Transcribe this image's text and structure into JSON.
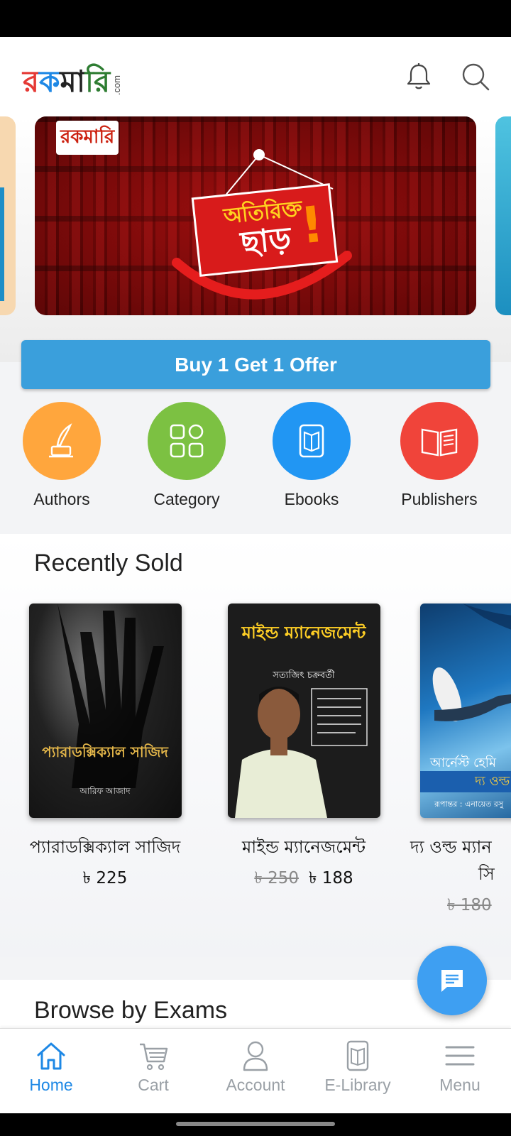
{
  "header": {
    "logo_text": "রকমারি",
    "logo_suffix": ".com"
  },
  "banner": {
    "logo_text": "রকমারি",
    "headline_line1": "অতিরিক্ত",
    "headline_line2": "ছাড়",
    "headline_mark": "!"
  },
  "offer_button": {
    "label": "Buy 1 Get 1 Offer"
  },
  "quick_links": [
    {
      "label": "Authors",
      "icon": "quill-inkpot-icon",
      "color": "#ffa63d"
    },
    {
      "label": "Category",
      "icon": "grid-icon",
      "color": "#7cc142"
    },
    {
      "label": "Ebooks",
      "icon": "ebook-reader-icon",
      "color": "#2196f3"
    },
    {
      "label": "Publishers",
      "icon": "open-book-icon",
      "color": "#f0443a"
    }
  ],
  "recently_sold": {
    "title": "Recently Sold",
    "books": [
      {
        "title": "প্যারাডক্সিক্যাল সাজিদ",
        "old_price": "",
        "price": "৳ 225",
        "cover_title": "প্যারাডক্সিক্যাল সাজিদ",
        "cover_author": "আরিফ আজাদ"
      },
      {
        "title": "মাইন্ড ম্যানেজমেন্ট",
        "old_price": "৳ 250",
        "price": "৳ 188",
        "cover_title": "মাইন্ড ম্যানেজমেন্ট",
        "cover_author": "সত্যজিৎ চক্রবর্তী"
      },
      {
        "title": "দ্য ওল্ড ম্যান",
        "title_line2": "সি",
        "old_price": "৳ 180",
        "price": "",
        "cover_title": "আর্নেস্ট হেমি",
        "cover_subtitle": "দ্য ওল্ড ম্যান এন্ড",
        "cover_author": "রূপান্তর : এনায়েত রসু"
      }
    ]
  },
  "browse_exams": {
    "title": "Browse by Exams"
  },
  "bottom_nav": [
    {
      "label": "Home",
      "icon": "home-icon",
      "active": true
    },
    {
      "label": "Cart",
      "icon": "cart-icon",
      "active": false
    },
    {
      "label": "Account",
      "icon": "account-icon",
      "active": false
    },
    {
      "label": "E-Library",
      "icon": "e-library-icon",
      "active": false
    },
    {
      "label": "Menu",
      "icon": "menu-icon",
      "active": false
    }
  ],
  "colors": {
    "accent": "#1e88e5",
    "offer_button": "#3a9fdc",
    "fab": "#3e9ff2"
  }
}
